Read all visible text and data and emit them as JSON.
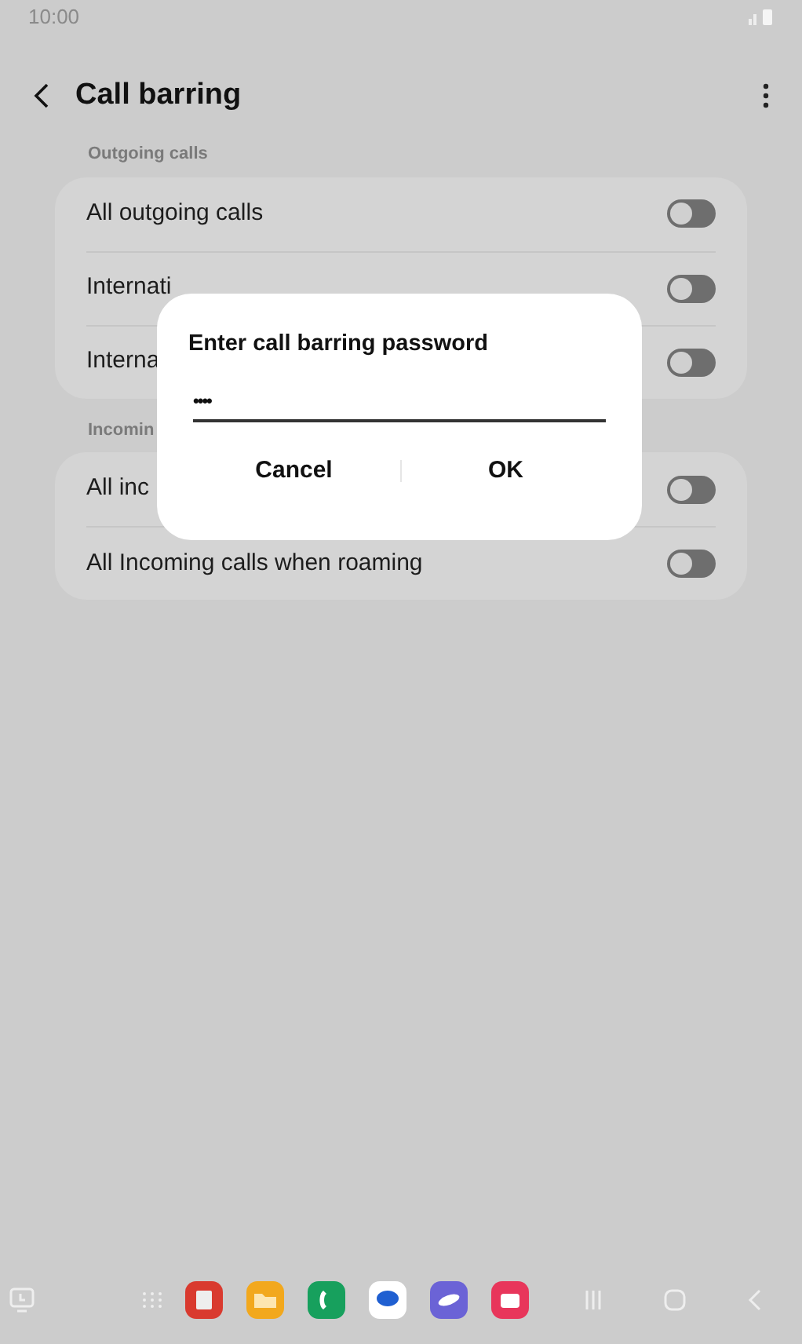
{
  "status_bar": {
    "time": "10:00"
  },
  "header": {
    "title": "Call barring"
  },
  "sections": [
    {
      "heading": "Outgoing calls",
      "rows": [
        {
          "label": "All outgoing calls",
          "on": false
        },
        {
          "label": "Internati",
          "on": false
        },
        {
          "label": "Interna",
          "on": false
        }
      ]
    },
    {
      "heading": "Incomin",
      "rows": [
        {
          "label": "All inc",
          "on": false
        },
        {
          "label": "All Incoming calls when roaming",
          "on": false
        }
      ]
    }
  ],
  "dialog": {
    "title": "Enter call barring password",
    "value": "••••",
    "buttons": [
      "Cancel",
      "OK"
    ]
  },
  "dock": {
    "apps": [
      {
        "kind": "notes",
        "color": "#d93a2f"
      },
      {
        "kind": "files",
        "color": "#f2a81d"
      },
      {
        "kind": "phone",
        "color": "#17a05d"
      },
      {
        "kind": "messages",
        "color": "#ffffff"
      },
      {
        "kind": "browser",
        "color": "#6b63d6"
      },
      {
        "kind": "camera",
        "color": "#e8365b"
      }
    ]
  }
}
